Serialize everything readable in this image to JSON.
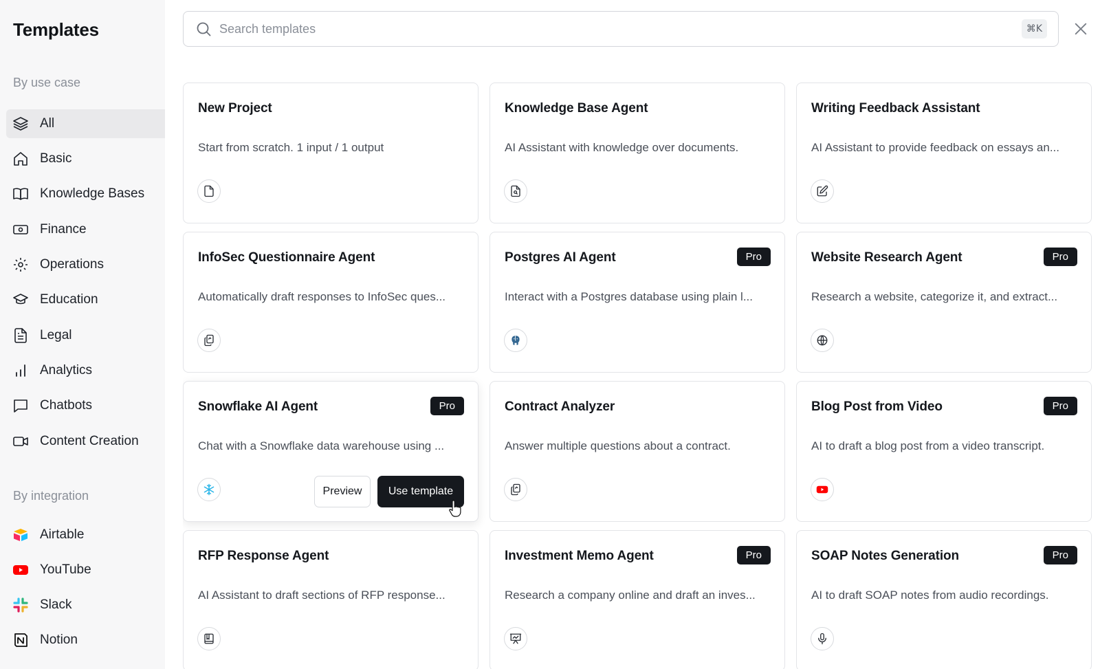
{
  "sidebar": {
    "title": "Templates",
    "use_case_heading": "By use case",
    "integration_heading": "By integration",
    "use_cases": [
      {
        "label": "All",
        "icon": "layers-icon",
        "active": true
      },
      {
        "label": "Basic",
        "icon": "home-icon"
      },
      {
        "label": "Knowledge Bases",
        "icon": "book-open-icon"
      },
      {
        "label": "Finance",
        "icon": "banknote-icon"
      },
      {
        "label": "Operations",
        "icon": "gear-icon"
      },
      {
        "label": "Education",
        "icon": "graduation-cap-icon"
      },
      {
        "label": "Legal",
        "icon": "document-text-icon"
      },
      {
        "label": "Analytics",
        "icon": "bar-chart-icon"
      },
      {
        "label": "Chatbots",
        "icon": "chat-bubble-icon"
      },
      {
        "label": "Content Creation",
        "icon": "video-camera-icon"
      }
    ],
    "integrations": [
      {
        "label": "Airtable",
        "icon": "airtable-logo-icon"
      },
      {
        "label": "YouTube",
        "icon": "youtube-logo-icon"
      },
      {
        "label": "Slack",
        "icon": "slack-logo-icon"
      },
      {
        "label": "Notion",
        "icon": "notion-logo-icon"
      }
    ]
  },
  "search": {
    "placeholder": "Search templates",
    "shortcut": "⌘K"
  },
  "cards": [
    {
      "title": "New Project",
      "desc": "Start from scratch. 1 input / 1 output",
      "icon": "file-icon",
      "pro": false
    },
    {
      "title": "Knowledge Base Agent",
      "desc": "AI Assistant with knowledge over documents.",
      "icon": "file-search-icon",
      "pro": false
    },
    {
      "title": "Writing Feedback Assistant",
      "desc": "AI Assistant to provide feedback on essays an...",
      "icon": "pencil-square-icon",
      "pro": false
    },
    {
      "title": "InfoSec Questionnaire Agent",
      "desc": "Automatically draft responses to InfoSec ques...",
      "icon": "copy-files-icon",
      "pro": false
    },
    {
      "title": "Postgres AI Agent",
      "desc": "Interact with a Postgres database using plain l...",
      "icon": "postgres-elephant-icon",
      "pro": true
    },
    {
      "title": "Website Research Agent",
      "desc": "Research a website, categorize it, and extract...",
      "icon": "globe-icon",
      "pro": true
    },
    {
      "title": "Snowflake AI Agent",
      "desc": "Chat with a Snowflake data warehouse using ...",
      "icon": "snowflake-icon",
      "pro": true,
      "hover": true
    },
    {
      "title": "Contract Analyzer",
      "desc": "Answer multiple questions about a contract.",
      "icon": "copy-files-icon",
      "pro": false
    },
    {
      "title": "Blog Post from Video",
      "desc": "AI to draft a blog post from a video transcript.",
      "icon": "youtube-logo-icon",
      "pro": true
    },
    {
      "title": "RFP Response Agent",
      "desc": "AI Assistant to draft sections of RFP response...",
      "icon": "book-icon",
      "pro": false
    },
    {
      "title": "Investment Memo Agent",
      "desc": "Research a company online and draft an inves...",
      "icon": "presentation-chart-icon",
      "pro": true
    },
    {
      "title": "SOAP Notes Generation",
      "desc": "AI to draft SOAP notes from audio recordings.",
      "icon": "microphone-icon",
      "pro": true
    }
  ],
  "labels": {
    "pro": "Pro",
    "preview": "Preview",
    "use_template": "Use template"
  },
  "colors": {
    "sidebar_bg": "#f7f7f8",
    "active_item_bg": "#e9e9eb",
    "primary_button": "#16191e",
    "youtube_red": "#ff0000",
    "snowflake_blue": "#29b5e8"
  }
}
